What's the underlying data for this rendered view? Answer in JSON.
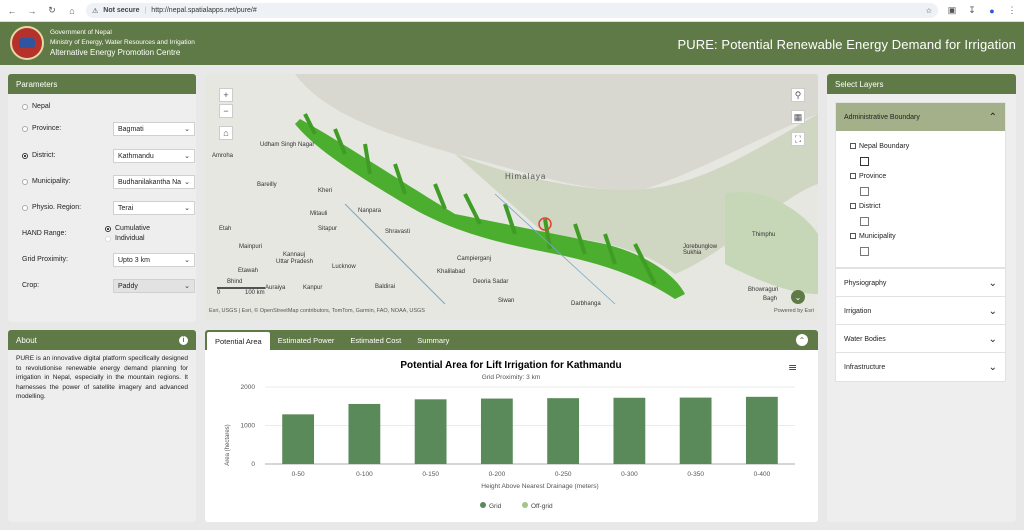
{
  "browser": {
    "not_secure": "Not secure",
    "url": "http://nepal.spatialapps.net/pure/#"
  },
  "header": {
    "org_line1": "Government of Nepal",
    "org_line2": "Ministry of Energy, Water Resources and Irrigation",
    "org_line3": "Alternative Energy Promotion Centre",
    "title": "PURE: Potential Renewable Energy Demand for Irrigation"
  },
  "parameters": {
    "title": "Parameters",
    "nepal_label": "Nepal",
    "province_label": "Province:",
    "province_value": "Bagmati",
    "district_label": "District:",
    "district_value": "Kathmandu",
    "municipality_label": "Municipality:",
    "municipality_value": "Budhanilakantha Na",
    "physio_label": "Physio. Region:",
    "physio_value": "Terai",
    "hand_label": "HAND Range:",
    "hand_opt1": "Cumulative",
    "hand_opt2": "Individual",
    "grid_label": "Grid Proximity:",
    "grid_value": "Upto 3 km",
    "crop_label": "Crop:",
    "crop_value": "Paddy"
  },
  "about": {
    "title": "About",
    "text": "PURE is an innovative digital platform specifically designed to revolutionise renewable energy demand planning for irrigation in Nepal, especially in the mountain regions. It harnesses the power of satellite imagery and advanced modelling."
  },
  "map": {
    "labels": [
      "Udham Singh Nagar",
      "Amroha",
      "Bareilly",
      "Kheri",
      "Mitauli",
      "Nanpara",
      "Shravasti",
      "Sitapur",
      "Etah",
      "Mainpuri",
      "Kannauj",
      "Uttar Pradesh",
      "Lucknow",
      "Etawah",
      "Bhind",
      "Auraiya",
      "Kanpur",
      "Baldirai",
      "Khalilabad",
      "Campierganj",
      "Deoria Sadar",
      "Siwan",
      "Darbhanga",
      "Himalaya",
      "Jorebunglow Sukhia",
      "Thimphu",
      "Bhowraguri",
      "Bagh"
    ],
    "attribution": "Esri, USGS | Esri, © OpenStreetMap contributors, TomTom, Garmin, FAO, NOAA, USGS",
    "powered": "Powered by Esri",
    "scale_mi": "0",
    "scale_km": "100 km"
  },
  "tabs": [
    "Potential Area",
    "Estimated Power",
    "Estimated Cost",
    "Summary"
  ],
  "chart_data": {
    "type": "bar",
    "title": "Potential Area for Lift Irrigation for Kathmandu",
    "subtitle": "Grid Proximity: 3 km",
    "xlabel": "Height Above Nearest Drainage (meters)",
    "ylabel": "Area (hectares)",
    "categories": [
      "0-50",
      "0-100",
      "0-150",
      "0-200",
      "0-250",
      "0-300",
      "0-350",
      "0-400"
    ],
    "series": [
      {
        "name": "Grid",
        "values": [
          1290,
          1560,
          1680,
          1700,
          1710,
          1720,
          1725,
          1745
        ]
      },
      {
        "name": "Off-grid",
        "values": [
          0,
          0,
          0,
          0,
          0,
          0,
          0,
          0
        ]
      }
    ],
    "ylim": [
      0,
      2000
    ],
    "yticks": [
      "0",
      "1000",
      "2000"
    ],
    "colors": {
      "grid": "#5a8a5a",
      "offgrid": "#a3c48a"
    },
    "legend": "bottom"
  },
  "layers": {
    "title": "Select Layers",
    "admin": "Administrative Boundary",
    "admin_items": [
      "Nepal Boundary",
      "Province",
      "District",
      "Municipality"
    ],
    "sections": [
      "Physiography",
      "Irrigation",
      "Water Bodies",
      "Infrastructure"
    ]
  }
}
